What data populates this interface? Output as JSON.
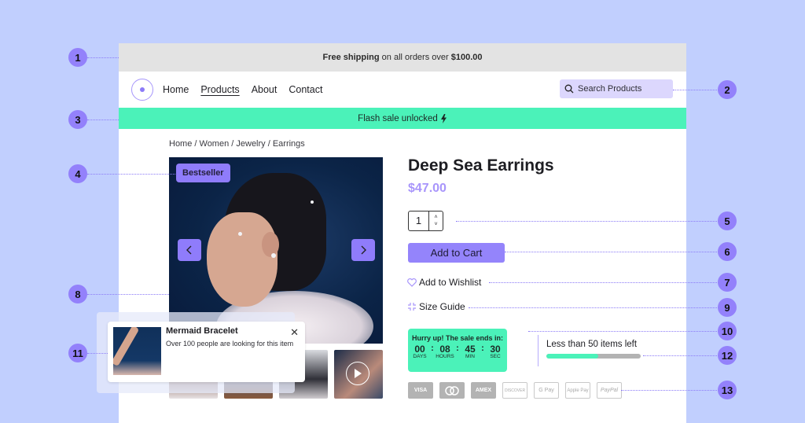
{
  "announcement": {
    "bold1": "Free shipping",
    "text": " on all orders over ",
    "bold2": "$100.00"
  },
  "nav": {
    "items": [
      "Home",
      "Products",
      "About",
      "Contact"
    ],
    "active": "Products",
    "search_placeholder": "Search Products"
  },
  "flash": {
    "text": "Flash sale unlocked"
  },
  "breadcrumb": "Home / Women / Jewelry / Earrings",
  "gallery": {
    "badge": "Bestseller",
    "thumbnails": 4
  },
  "product": {
    "title": "Deep Sea Earrings",
    "price": "$47.00",
    "quantity": "1",
    "add_to_cart": "Add to Cart",
    "wishlist": "Add to Wishlist",
    "size_guide": "Size Guide"
  },
  "timer": {
    "heading": "Hurry up! The sale ends in:",
    "days": "00",
    "hours": "08",
    "min": "45",
    "sec": "30",
    "labels": [
      "DAYS",
      "HOURS",
      "MIN",
      "SEC"
    ]
  },
  "stock": {
    "text": "Less than 50 items left",
    "progress": 0.55
  },
  "payments": [
    "VISA",
    "Mastercard",
    "AMEX",
    "DISCOVER",
    "G Pay",
    "Apple Pay",
    "PayPal"
  ],
  "popup": {
    "title": "Mermaid Bracelet",
    "subtitle": "Over 100 people are looking for this item"
  },
  "callouts": [
    "1",
    "2",
    "3",
    "4",
    "5",
    "6",
    "7",
    "8",
    "9",
    "10",
    "11",
    "12",
    "13"
  ],
  "colors": {
    "accent": "#9381fb",
    "flash": "#4bf2b9",
    "background": "#c1cffe"
  }
}
